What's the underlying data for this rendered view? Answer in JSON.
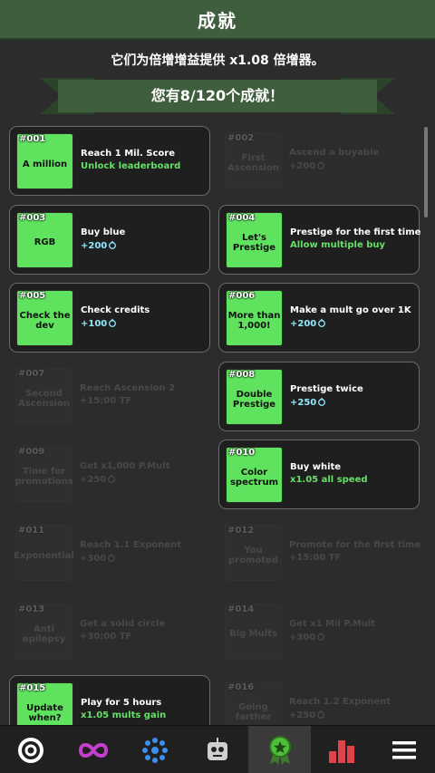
{
  "header": {
    "title": "成就"
  },
  "bonus_text": "它们为倍增增益提供 x1.08 倍增器。",
  "ribbon_text": "您有8/120个成就！",
  "achievements": [
    {
      "num": "#001",
      "name": "A million",
      "desc": "Reach 1 Mil. Score",
      "reward": "Unlock leaderboard",
      "reward_type": "green",
      "unlocked": true
    },
    {
      "num": "#002",
      "name": "First Ascension",
      "desc": "Ascend a buyable",
      "reward": "+200",
      "reward_type": "cyan",
      "unlocked": false
    },
    {
      "num": "#003",
      "name": "RGB",
      "desc": "Buy blue",
      "reward": "+200",
      "reward_type": "cyan",
      "unlocked": true
    },
    {
      "num": "#004",
      "name": "Let's Prestige",
      "desc": "Prestige for the first time",
      "reward": "Allow multiple buy",
      "reward_type": "green",
      "unlocked": true
    },
    {
      "num": "#005",
      "name": "Check the dev",
      "desc": "Check credits",
      "reward": "+100",
      "reward_type": "cyan",
      "unlocked": true
    },
    {
      "num": "#006",
      "name": "More than 1,000!",
      "desc": "Make a mult go over 1K",
      "reward": "+200",
      "reward_type": "cyan",
      "unlocked": true
    },
    {
      "num": "#007",
      "name": "Second Ascension",
      "desc": "Reach Ascension 2",
      "reward": "+15:00 TF",
      "reward_type": "green",
      "unlocked": false
    },
    {
      "num": "#008",
      "name": "Double Prestige",
      "desc": "Prestige twice",
      "reward": "+250",
      "reward_type": "cyan",
      "unlocked": true
    },
    {
      "num": "#009",
      "name": "Time for promotions",
      "desc": "Get x1,000 P.Mult",
      "reward": "+250",
      "reward_type": "cyan",
      "unlocked": false
    },
    {
      "num": "#010",
      "name": "Color spectrum",
      "desc": "Buy white",
      "reward": "x1.05 all speed",
      "reward_type": "green",
      "unlocked": true
    },
    {
      "num": "#011",
      "name": "Exponential",
      "desc": "Reach 1.1 Exponent",
      "reward": "+300",
      "reward_type": "cyan",
      "unlocked": false
    },
    {
      "num": "#012",
      "name": "You promoted",
      "desc": "Promote for the first time",
      "reward": "+15:00 TF",
      "reward_type": "green",
      "unlocked": false
    },
    {
      "num": "#013",
      "name": "Anti epilepsy",
      "desc": "Get a solid circle",
      "reward": "+30:00 TF",
      "reward_type": "green",
      "unlocked": false
    },
    {
      "num": "#014",
      "name": "Big Mults",
      "desc": "Get x1 Mil P.Mult",
      "reward": "+300",
      "reward_type": "cyan",
      "unlocked": false
    },
    {
      "num": "#015",
      "name": "Update when?",
      "desc": "Play for 5 hours",
      "reward": "x1.05 mults gain",
      "reward_type": "green",
      "unlocked": true
    },
    {
      "num": "#016",
      "name": "Going farther",
      "desc": "Reach 1.2 Exponent",
      "reward": "+250",
      "reward_type": "cyan",
      "unlocked": false
    }
  ],
  "nav": [
    {
      "name": "nav-circle",
      "icon": "target-ring-icon"
    },
    {
      "name": "nav-infinity",
      "icon": "infinity-icon"
    },
    {
      "name": "nav-dots",
      "icon": "dot-cluster-icon"
    },
    {
      "name": "nav-robot",
      "icon": "robot-icon"
    },
    {
      "name": "nav-achievements",
      "icon": "award-ribbon-icon",
      "active": true
    },
    {
      "name": "nav-stats",
      "icon": "bar-chart-icon"
    },
    {
      "name": "nav-menu",
      "icon": "menu-icon"
    }
  ],
  "colors": {
    "header": "#3f5e3d",
    "badge": "#5fe35f",
    "reward_green": "#66e066",
    "reward_cyan": "#8fe9ff",
    "stats_icon": "#e0434a",
    "infinity_icon": "#c23fd0",
    "dots_icon": "#3a8ff0"
  }
}
